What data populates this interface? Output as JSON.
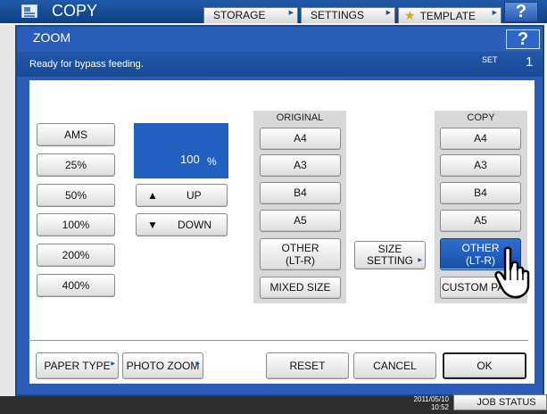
{
  "topbar": {
    "title": "COPY",
    "tabs": [
      "STORAGE",
      "SETTINGS",
      "TEMPLATE"
    ],
    "help": "?"
  },
  "dialog": {
    "title": "ZOOM",
    "help": "?",
    "status": "Ready for bypass feeding.",
    "set_label": "SET",
    "copies": "1"
  },
  "presets": [
    "AMS",
    "25%",
    "50%",
    "100%",
    "200%",
    "400%"
  ],
  "zoom": {
    "value": "100",
    "unit": "%",
    "up": "UP",
    "down": "DOWN"
  },
  "original": {
    "label": "ORIGINAL",
    "sizes": [
      "A4",
      "A3",
      "B4",
      "A5"
    ],
    "other": [
      "OTHER",
      "(LT-R)"
    ],
    "mixed": "MIXED SIZE"
  },
  "size_setting": [
    "SIZE",
    "SETTING"
  ],
  "copy": {
    "label": "COPY",
    "sizes": [
      "A4",
      "A3",
      "B4",
      "A5"
    ],
    "other": [
      "OTHER",
      "(LT-R)"
    ],
    "custom": "CUSTOM PA"
  },
  "bottom": {
    "paper_type": "PAPER TYPE",
    "photo_zoom": "PHOTO ZOOM",
    "reset": "RESET",
    "cancel": "CANCEL",
    "ok": "OK"
  },
  "footer": {
    "datetime": [
      "2011/05/10",
      "10:52"
    ],
    "job_status": "JOB STATUS"
  },
  "colors": {
    "accent": "#2160c0",
    "selected": "#1f5ab8"
  },
  "icons": {
    "up": "triangle-up-icon",
    "down": "triangle-down-icon",
    "hand": "pointer-hand-icon",
    "star": "star-icon"
  }
}
